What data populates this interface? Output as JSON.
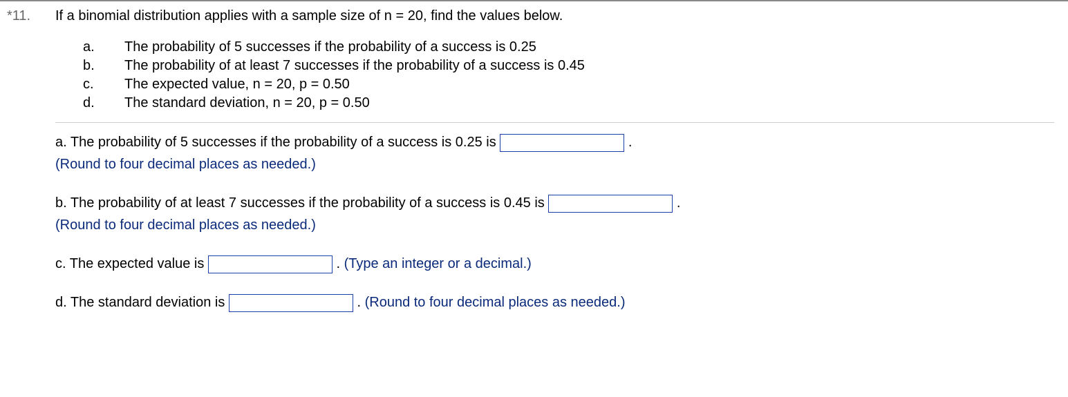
{
  "question": {
    "marker_prefix": "*",
    "number": "11.",
    "stem": "If a binomial distribution applies with a sample size of n = 20, find the values below.",
    "subparts": [
      {
        "label": "a.",
        "text": "The probability of 5 successes if the probability of a success is 0.25"
      },
      {
        "label": "b.",
        "text": "The probability of at least 7 successes if the probability of a success is 0.45"
      },
      {
        "label": "c.",
        "text": "The expected value, n = 20, p = 0.50"
      },
      {
        "label": "d.",
        "text": "The standard deviation, n = 20, p = 0.50"
      }
    ]
  },
  "answers": {
    "a": {
      "prompt_before": "a. The probability of 5 successes if the probability of a success is 0.25 is ",
      "value": "",
      "punct": ".",
      "hint": "(Round to four decimal places as needed.)"
    },
    "b": {
      "prompt_before": "b. The probability of at least 7 successes if the probability of a success is 0.45 is ",
      "value": "",
      "punct": ".",
      "hint": "(Round to four decimal places as needed.)"
    },
    "c": {
      "prompt_before": "c. The expected value is ",
      "value": "",
      "punct": ". ",
      "hint": "(Type an integer or a decimal.)"
    },
    "d": {
      "prompt_before": "d. The standard deviation is ",
      "value": "",
      "punct": ". ",
      "hint": "(Round to four decimal places as needed.)"
    }
  }
}
